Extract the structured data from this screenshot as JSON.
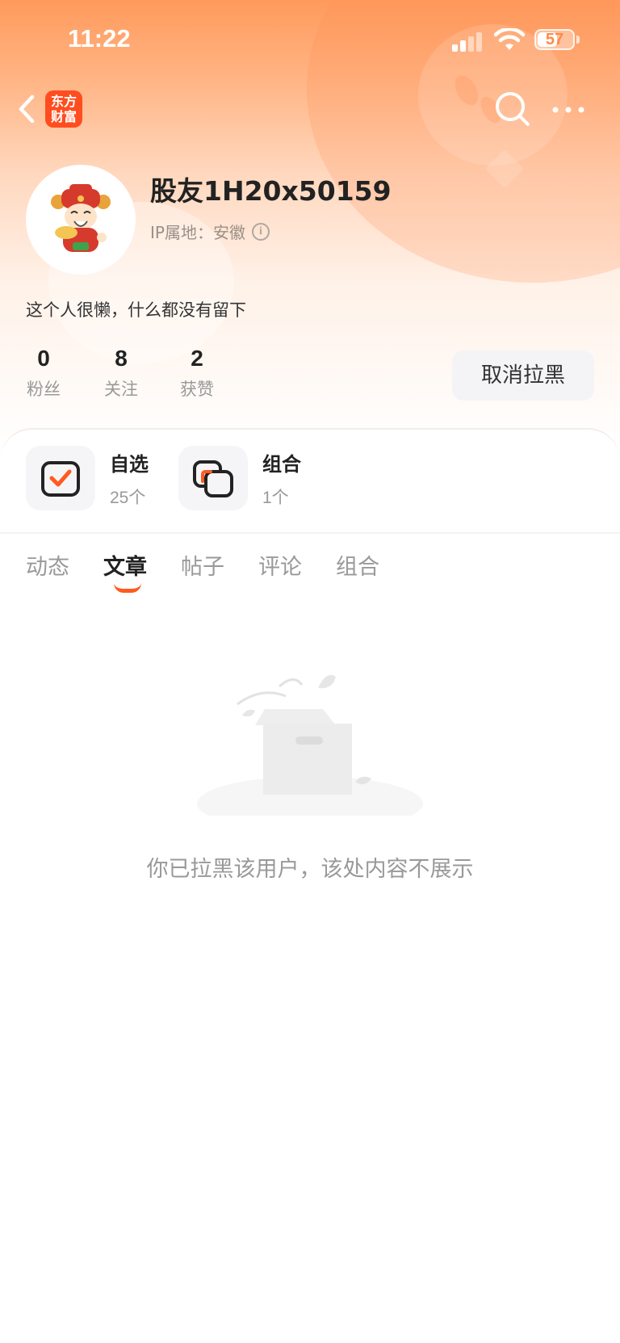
{
  "status_bar": {
    "time": "11:22",
    "battery": "57",
    "battery_level": 0.57
  },
  "nav": {
    "logo_text": "东方财富"
  },
  "profile": {
    "username": "股友1H20x50159",
    "ip_location": "IP属地：安徽",
    "bio": "这个人很懒，什么都没有留下"
  },
  "stats": [
    {
      "value": "0",
      "label": "粉丝"
    },
    {
      "value": "8",
      "label": "关注"
    },
    {
      "value": "2",
      "label": "获赞"
    }
  ],
  "unblock_label": "取消拉黑",
  "quick_links": [
    {
      "title": "自选",
      "subtitle": "25个",
      "icon": "checklist-icon"
    },
    {
      "title": "组合",
      "subtitle": "1个",
      "icon": "portfolio-icon"
    }
  ],
  "tabs": [
    {
      "label": "动态",
      "active": false
    },
    {
      "label": "文章",
      "active": true
    },
    {
      "label": "帖子",
      "active": false
    },
    {
      "label": "评论",
      "active": false
    },
    {
      "label": "组合",
      "active": false
    }
  ],
  "empty_state": {
    "message": "你已拉黑该用户，该处内容不展示"
  },
  "colors": {
    "accent": "#ff5a1f",
    "hero_top": "#ff9a5c",
    "logo_bg": "#ff4d1f"
  }
}
